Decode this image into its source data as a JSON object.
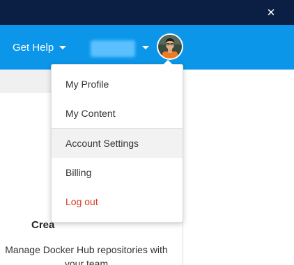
{
  "window": {
    "close_glyph": "✕"
  },
  "navbar": {
    "get_help_label": "Get Help",
    "username_label": "",
    "avatar_icon": "user-avatar",
    "colors": {
      "titlebar": "#0b1f45",
      "navbar": "#0b96e9"
    }
  },
  "dropdown": {
    "items": [
      {
        "label": "My Profile"
      },
      {
        "label": "My Content"
      },
      {
        "label": "Account Settings"
      },
      {
        "label": "Billing"
      },
      {
        "label": "Log out"
      }
    ],
    "hovered_item": "Account Settings",
    "logout_color": "#d93a26"
  },
  "card": {
    "title": "Crea",
    "description": "Manage Docker Hub repositories with your team"
  }
}
